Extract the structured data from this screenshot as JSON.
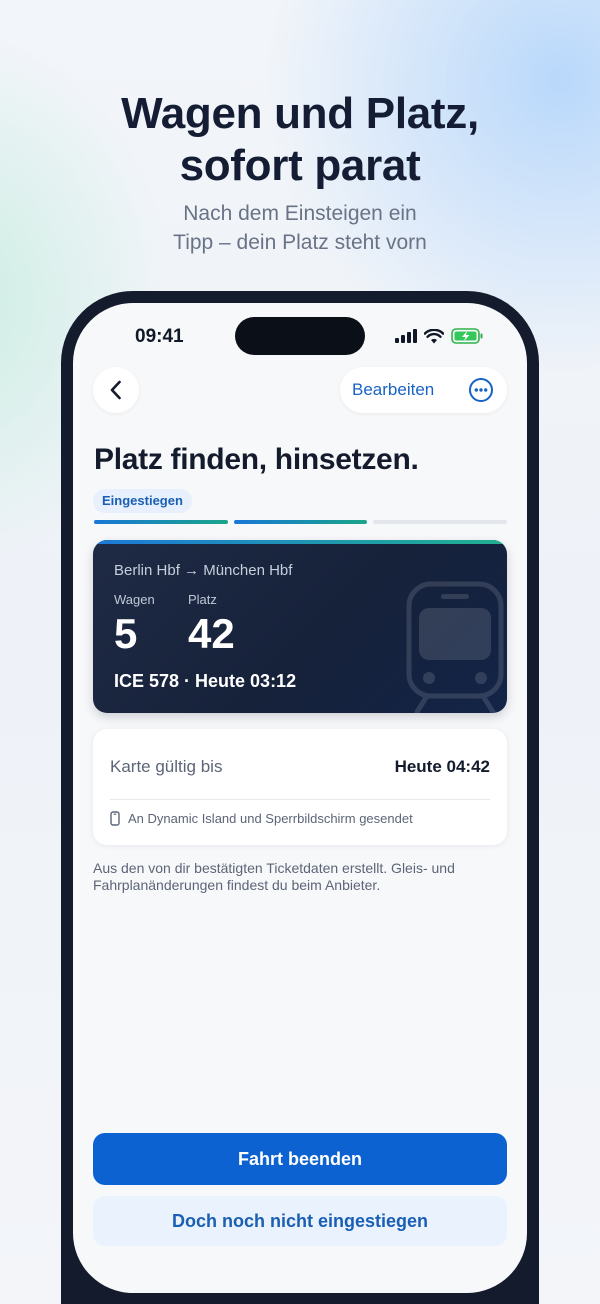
{
  "promo": {
    "headline_line1": "Wagen und Platz,",
    "headline_line2": "sofort parat",
    "subline_line1": "Nach dem Einsteigen ein",
    "subline_line2": "Tipp – dein Platz steht vorn"
  },
  "status_bar": {
    "time": "09:41",
    "icons": [
      "cellular-signal-icon",
      "wifi-icon",
      "battery-charging-icon"
    ]
  },
  "nav": {
    "back_icon": "chevron-left-icon",
    "edit_label": "Bearbeiten",
    "more_icon": "ellipsis-circle-icon"
  },
  "page": {
    "title": "Platz finden, hinsetzen.",
    "status_badge": "Eingestiegen",
    "progress_steps_total": 3,
    "progress_steps_done": 2
  },
  "ticket": {
    "from": "Berlin Hbf",
    "arrow": "→",
    "to": "München Hbf",
    "wagen_label": "Wagen",
    "wagen_value": "5",
    "platz_label": "Platz",
    "platz_value": "42",
    "trip": "ICE 578 · Heute 03:12",
    "icon": "train-icon"
  },
  "validity": {
    "label": "Karte gültig bis",
    "value": "Heute 04:42",
    "sent_icon": "phone-icon",
    "sent_text": "An Dynamic Island und Sperrbildschirm gesendet"
  },
  "note": "Aus den von dir bestätigten Ticketdaten erstellt. Gleis- und Fahrplanänderungen findest du beim Anbieter.",
  "actions": {
    "primary": "Fahrt beenden",
    "secondary": "Doch noch nicht eingestiegen"
  },
  "colors": {
    "accent_blue": "#0c62d1",
    "text_dark": "#131b2d",
    "ticket_bg": "#1f2a44",
    "gradient_green": "#21b08f"
  }
}
